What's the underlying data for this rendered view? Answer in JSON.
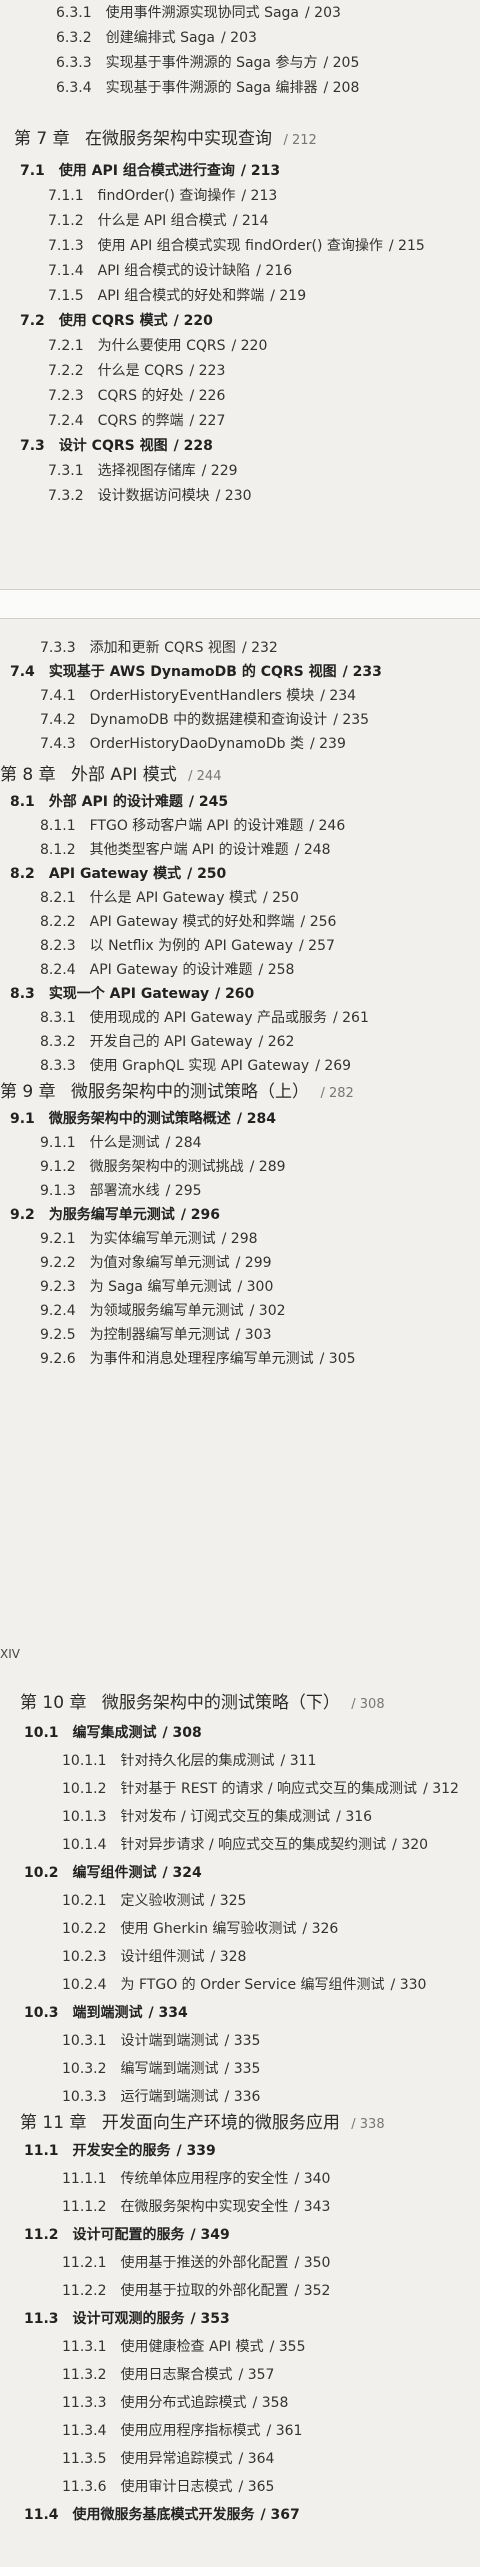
{
  "segment1": {
    "lines": [
      {
        "n": "6.3.1",
        "t": "使用事件溯源实现协同式 Saga",
        "p": "/ 203"
      },
      {
        "n": "6.3.2",
        "t": "创建编排式 Saga",
        "p": "/ 203"
      },
      {
        "n": "6.3.3",
        "t": "实现基于事件溯源的 Saga 参与方",
        "p": "/ 205"
      },
      {
        "n": "6.3.4",
        "t": "实现基于事件溯源的 Saga 编排器",
        "p": "/ 208"
      }
    ],
    "chapter7": {
      "label": "第 7 章",
      "title": "在微服务架构中实现查询",
      "p": "/ 212"
    },
    "items": [
      {
        "n": "7.1",
        "t": "使用 API 组合模式进行查询",
        "p": "/ 213",
        "lvl": "sec"
      },
      {
        "n": "7.1.1",
        "t": "findOrder() 查询操作",
        "p": "/ 213",
        "lvl": "sub"
      },
      {
        "n": "7.1.2",
        "t": "什么是 API 组合模式",
        "p": "/ 214",
        "lvl": "sub"
      },
      {
        "n": "7.1.3",
        "t": "使用 API 组合模式实现 findOrder() 查询操作",
        "p": "/ 215",
        "lvl": "sub"
      },
      {
        "n": "7.1.4",
        "t": "API 组合模式的设计缺陷",
        "p": "/ 216",
        "lvl": "sub"
      },
      {
        "n": "7.1.5",
        "t": "API 组合模式的好处和弊端",
        "p": "/ 219",
        "lvl": "sub"
      },
      {
        "n": "7.2",
        "t": "使用 CQRS 模式",
        "p": "/ 220",
        "lvl": "sec"
      },
      {
        "n": "7.2.1",
        "t": "为什么要使用 CQRS",
        "p": "/ 220",
        "lvl": "sub"
      },
      {
        "n": "7.2.2",
        "t": "什么是 CQRS",
        "p": "/ 223",
        "lvl": "sub"
      },
      {
        "n": "7.2.3",
        "t": "CQRS 的好处",
        "p": "/ 226",
        "lvl": "sub"
      },
      {
        "n": "7.2.4",
        "t": "CQRS 的弊端",
        "p": "/ 227",
        "lvl": "sub"
      },
      {
        "n": "7.3",
        "t": "设计 CQRS 视图",
        "p": "/ 228",
        "lvl": "sec"
      },
      {
        "n": "7.3.1",
        "t": "选择视图存储库",
        "p": "/ 229",
        "lvl": "sub"
      },
      {
        "n": "7.3.2",
        "t": "设计数据访问模块",
        "p": "/ 230",
        "lvl": "sub"
      }
    ]
  },
  "segment2": {
    "items": [
      {
        "n": "7.3.3",
        "t": "添加和更新 CQRS 视图",
        "p": "/ 232",
        "lvl": "sub"
      },
      {
        "n": "7.4",
        "t": "实现基于 AWS DynamoDB 的 CQRS 视图",
        "p": "/ 233",
        "lvl": "sec"
      },
      {
        "n": "7.4.1",
        "t": "OrderHistoryEventHandlers 模块",
        "p": "/ 234",
        "lvl": "sub"
      },
      {
        "n": "7.4.2",
        "t": "DynamoDB 中的数据建模和查询设计",
        "p": "/ 235",
        "lvl": "sub"
      },
      {
        "n": "7.4.3",
        "t": "OrderHistoryDaoDynamoDb 类",
        "p": "/ 239",
        "lvl": "sub"
      }
    ],
    "chapter8": {
      "label": "第 8 章",
      "title": "外部 API 模式",
      "p": "/ 244"
    },
    "items8": [
      {
        "n": "8.1",
        "t": "外部 API 的设计难题",
        "p": "/ 245",
        "lvl": "sec"
      },
      {
        "n": "8.1.1",
        "t": "FTGO 移动客户端 API 的设计难题",
        "p": "/ 246",
        "lvl": "sub"
      },
      {
        "n": "8.1.2",
        "t": "其他类型客户端 API 的设计难题",
        "p": "/ 248",
        "lvl": "sub"
      },
      {
        "n": "8.2",
        "t": "API Gateway 模式",
        "p": "/ 250",
        "lvl": "sec"
      },
      {
        "n": "8.2.1",
        "t": "什么是 API Gateway 模式",
        "p": "/ 250",
        "lvl": "sub"
      },
      {
        "n": "8.2.2",
        "t": "API Gateway 模式的好处和弊端",
        "p": "/ 256",
        "lvl": "sub"
      },
      {
        "n": "8.2.3",
        "t": "以 Netflix 为例的 API Gateway",
        "p": "/ 257",
        "lvl": "sub"
      },
      {
        "n": "8.2.4",
        "t": "API Gateway 的设计难题",
        "p": "/ 258",
        "lvl": "sub"
      },
      {
        "n": "8.3",
        "t": "实现一个 API Gateway",
        "p": "/ 260",
        "lvl": "sec"
      },
      {
        "n": "8.3.1",
        "t": "使用现成的 API Gateway 产品或服务",
        "p": "/ 261",
        "lvl": "sub"
      },
      {
        "n": "8.3.2",
        "t": "开发自己的 API Gateway",
        "p": "/ 262",
        "lvl": "sub"
      },
      {
        "n": "8.3.3",
        "t": "使用 GraphQL 实现 API Gateway",
        "p": "/ 269",
        "lvl": "sub"
      }
    ],
    "chapter9": {
      "label": "第 9 章",
      "title": "微服务架构中的测试策略（上）",
      "p": "/ 282"
    },
    "items9": [
      {
        "n": "9.1",
        "t": "微服务架构中的测试策略概述",
        "p": "/ 284",
        "lvl": "sec"
      },
      {
        "n": "9.1.1",
        "t": "什么是测试",
        "p": "/ 284",
        "lvl": "sub"
      },
      {
        "n": "9.1.2",
        "t": "微服务架构中的测试挑战",
        "p": "/ 289",
        "lvl": "sub"
      },
      {
        "n": "9.1.3",
        "t": "部署流水线",
        "p": "/ 295",
        "lvl": "sub"
      },
      {
        "n": "9.2",
        "t": "为服务编写单元测试",
        "p": "/ 296",
        "lvl": "sec"
      },
      {
        "n": "9.2.1",
        "t": "为实体编写单元测试",
        "p": "/ 298",
        "lvl": "sub"
      },
      {
        "n": "9.2.2",
        "t": "为值对象编写单元测试",
        "p": "/ 299",
        "lvl": "sub"
      },
      {
        "n": "9.2.3",
        "t": "为 Saga 编写单元测试",
        "p": "/ 300",
        "lvl": "sub"
      },
      {
        "n": "9.2.4",
        "t": "为领域服务编写单元测试",
        "p": "/ 302",
        "lvl": "sub"
      },
      {
        "n": "9.2.5",
        "t": "为控制器编写单元测试",
        "p": "/ 303",
        "lvl": "sub"
      },
      {
        "n": "9.2.6",
        "t": "为事件和消息处理程序编写单元测试",
        "p": "/ 305",
        "lvl": "sub"
      }
    ]
  },
  "segment3": {
    "page_label": "XIV",
    "chapter10": {
      "label": "第 10 章",
      "title": "微服务架构中的测试策略（下）",
      "p": "/ 308"
    },
    "items10": [
      {
        "n": "10.1",
        "t": "编写集成测试",
        "p": "/ 308",
        "lvl": "sec"
      },
      {
        "n": "10.1.1",
        "t": "针对持久化层的集成测试",
        "p": "/ 311",
        "lvl": "sub"
      },
      {
        "n": "10.1.2",
        "t": "针对基于 REST 的请求 / 响应式交互的集成测试",
        "p": "/ 312",
        "lvl": "sub"
      },
      {
        "n": "10.1.3",
        "t": "针对发布 / 订阅式交互的集成测试",
        "p": "/ 316",
        "lvl": "sub"
      },
      {
        "n": "10.1.4",
        "t": "针对异步请求 / 响应式交互的集成契约测试",
        "p": "/ 320",
        "lvl": "sub"
      },
      {
        "n": "10.2",
        "t": "编写组件测试",
        "p": "/ 324",
        "lvl": "sec"
      },
      {
        "n": "10.2.1",
        "t": "定义验收测试",
        "p": "/ 325",
        "lvl": "sub"
      },
      {
        "n": "10.2.2",
        "t": "使用 Gherkin 编写验收测试",
        "p": "/ 326",
        "lvl": "sub"
      },
      {
        "n": "10.2.3",
        "t": "设计组件测试",
        "p": "/ 328",
        "lvl": "sub"
      },
      {
        "n": "10.2.4",
        "t": "为 FTGO 的 Order Service 编写组件测试",
        "p": "/ 330",
        "lvl": "sub"
      },
      {
        "n": "10.3",
        "t": "端到端测试",
        "p": "/ 334",
        "lvl": "sec"
      },
      {
        "n": "10.3.1",
        "t": "设计端到端测试",
        "p": "/ 335",
        "lvl": "sub"
      },
      {
        "n": "10.3.2",
        "t": "编写端到端测试",
        "p": "/ 335",
        "lvl": "sub"
      },
      {
        "n": "10.3.3",
        "t": "运行端到端测试",
        "p": "/ 336",
        "lvl": "sub"
      }
    ],
    "chapter11": {
      "label": "第 11 章",
      "title": "开发面向生产环境的微服务应用",
      "p": "/ 338"
    },
    "items11": [
      {
        "n": "11.1",
        "t": "开发安全的服务",
        "p": "/ 339",
        "lvl": "sec"
      },
      {
        "n": "11.1.1",
        "t": "传统单体应用程序的安全性",
        "p": "/ 340",
        "lvl": "sub"
      },
      {
        "n": "11.1.2",
        "t": "在微服务架构中实现安全性",
        "p": "/ 343",
        "lvl": "sub"
      },
      {
        "n": "11.2",
        "t": "设计可配置的服务",
        "p": "/ 349",
        "lvl": "sec"
      },
      {
        "n": "11.2.1",
        "t": "使用基于推送的外部化配置",
        "p": "/ 350",
        "lvl": "sub"
      },
      {
        "n": "11.2.2",
        "t": "使用基于拉取的外部化配置",
        "p": "/ 352",
        "lvl": "sub"
      },
      {
        "n": "11.3",
        "t": "设计可观测的服务",
        "p": "/ 353",
        "lvl": "sec"
      },
      {
        "n": "11.3.1",
        "t": "使用健康检查 API 模式",
        "p": "/ 355",
        "lvl": "sub"
      },
      {
        "n": "11.3.2",
        "t": "使用日志聚合模式",
        "p": "/ 357",
        "lvl": "sub"
      },
      {
        "n": "11.3.3",
        "t": "使用分布式追踪模式",
        "p": "/ 358",
        "lvl": "sub"
      },
      {
        "n": "11.3.4",
        "t": "使用应用程序指标模式",
        "p": "/ 361",
        "lvl": "sub"
      },
      {
        "n": "11.3.5",
        "t": "使用异常追踪模式",
        "p": "/ 364",
        "lvl": "sub"
      },
      {
        "n": "11.3.6",
        "t": "使用审计日志模式",
        "p": "/ 365",
        "lvl": "sub"
      },
      {
        "n": "11.4",
        "t": "使用微服务基底模式开发服务",
        "p": "/ 367",
        "lvl": "sec"
      }
    ]
  }
}
